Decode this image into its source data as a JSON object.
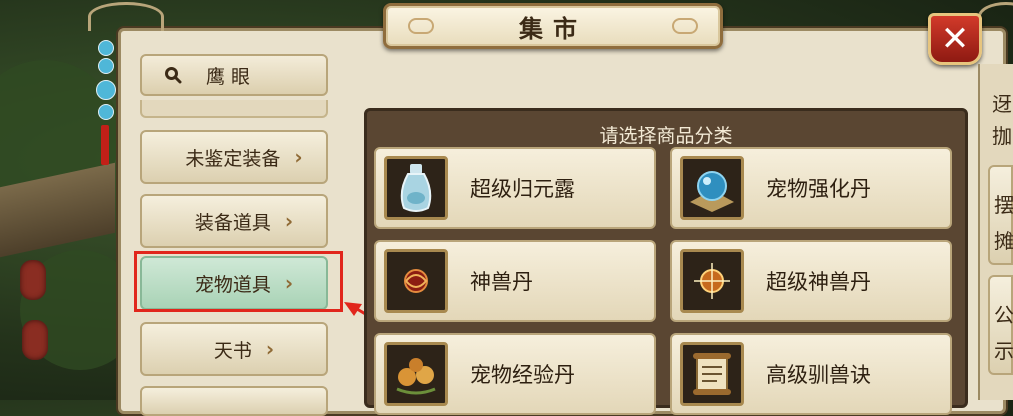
{
  "window": {
    "title": "集市",
    "close_symbol": "✕"
  },
  "search": {
    "label": "鹰眼",
    "icon": "search-icon"
  },
  "categories": [
    {
      "label": "未鉴定装备",
      "chevron": "›",
      "active": false
    },
    {
      "label": "装备道具",
      "chevron": "›",
      "active": false
    },
    {
      "label": "宠物道具",
      "chevron": "›",
      "active": true
    },
    {
      "label": "天书",
      "chevron": "›",
      "active": false
    }
  ],
  "goods": {
    "header": "请选择商品分类",
    "items": [
      {
        "name": "超级归元露",
        "icon": "potion-bottle-icon"
      },
      {
        "name": "宠物强化丹",
        "icon": "blue-orb-icon"
      },
      {
        "name": "神兽丹",
        "icon": "red-pill-icon"
      },
      {
        "name": "超级神兽丹",
        "icon": "golden-pill-icon"
      },
      {
        "name": "宠物经验丹",
        "icon": "fruit-pills-icon"
      },
      {
        "name": "高级驯兽诀",
        "icon": "scroll-icon"
      }
    ]
  },
  "right_panel": {
    "text_fragments": [
      "迓",
      "拁",
      "摆",
      "摊",
      "公",
      "示"
    ]
  },
  "colors": {
    "highlight": "#e1261c",
    "active_category": "#bfe0c8",
    "close_button": "#c2301f"
  }
}
